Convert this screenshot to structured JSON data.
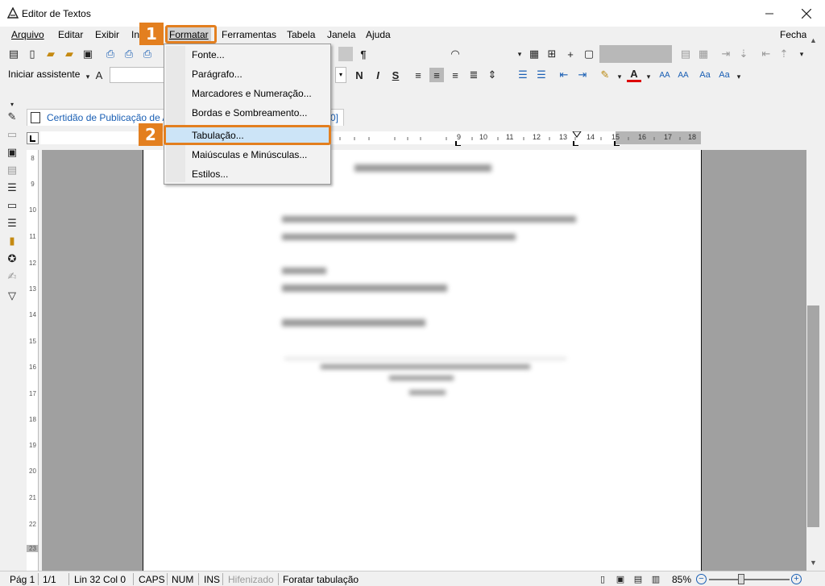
{
  "window": {
    "title": "Editor de Textos",
    "close_label": "Fechar"
  },
  "menubar": {
    "items": [
      "Arquivo",
      "Editar",
      "Exibir",
      "In",
      "Formatar",
      "Ferramentas",
      "Tabela",
      "Janela",
      "Ajuda"
    ]
  },
  "toolbar": {
    "assistant_label": "Iniciar assistente",
    "pilcrow": "¶"
  },
  "document_tab": {
    "label": "Certidão de Publicação de Ac",
    "suffix": "0]"
  },
  "horizontal_ruler": {
    "numbers": [
      "9",
      "10",
      "11",
      "12",
      "13",
      "14",
      "15",
      "16",
      "17",
      "18"
    ]
  },
  "vertical_ruler": {
    "numbers": [
      "8",
      "9",
      "10",
      "11",
      "12",
      "13",
      "14",
      "15",
      "16",
      "17",
      "18",
      "19",
      "20",
      "21",
      "22",
      "23"
    ]
  },
  "format_menu": {
    "items": [
      "Fonte...",
      "Parágrafo...",
      "Marcadores e Numeração...",
      "Bordas e Sombreamento...",
      "Tabulação...",
      "Maiúsculas e Minúsculas...",
      "Estilos..."
    ],
    "highlighted": "Tabulação..."
  },
  "callouts": [
    "1",
    "2"
  ],
  "statusbar": {
    "page": "Pág 1",
    "page_count": "1/1",
    "line_col": "Lin 32  Col 0",
    "caps": "CAPS",
    "num": "NUM",
    "ins": "INS",
    "hyphen": "Hifenizado",
    "message": "Foratar tabulação",
    "zoom": "85%"
  },
  "colors": {
    "accent": "#e37f1f",
    "link_blue": "#1a5fb4",
    "highlight": "#cce4f7"
  }
}
